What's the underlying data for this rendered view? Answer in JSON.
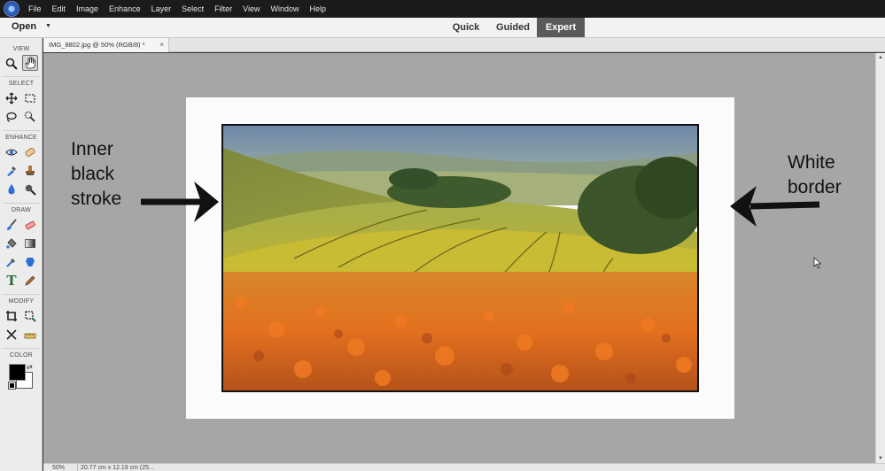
{
  "menubar": {
    "items": [
      "File",
      "Edit",
      "Image",
      "Enhance",
      "Layer",
      "Select",
      "Filter",
      "View",
      "Window",
      "Help"
    ]
  },
  "modebar": {
    "open_label": "Open",
    "tabs": {
      "quick": "Quick",
      "guided": "Guided",
      "expert": "Expert"
    },
    "active_tab": "Expert"
  },
  "toolbar": {
    "sections": {
      "view": "VIEW",
      "select": "SELECT",
      "enhance": "ENHANCE",
      "draw": "DRAW",
      "modify": "MODIFY",
      "color": "COLOR"
    },
    "foreground_color": "#000000",
    "background_color": "#ffffff"
  },
  "document": {
    "tab_title": "IMG_8802.jpg @ 50% (RGB/8) *",
    "close_glyph": "×"
  },
  "statusbar": {
    "zoom": "50%",
    "doc_info": "20.77 cm x 12.19 cm (25..."
  },
  "annotations": {
    "left": [
      "Inner",
      "black",
      "stroke"
    ],
    "right": [
      "White",
      "border"
    ]
  },
  "colors": {
    "canvas_bg": "#a6a6a6",
    "border": "#fbfbfb",
    "stroke": "#111111",
    "expert_tab": "#5a5a5a"
  }
}
